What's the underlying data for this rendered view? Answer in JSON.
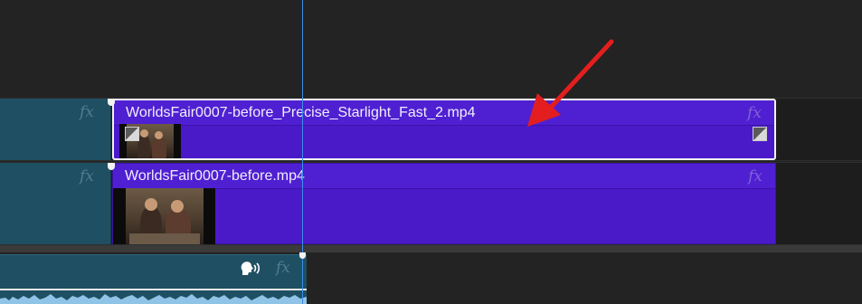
{
  "tracks": {
    "v2": {
      "left_fx": "fx",
      "clip": {
        "name": "WorldsFair0007-before_Precise_Starlight_Fast_2.mp4",
        "fx": "fx",
        "selected": true
      }
    },
    "v1": {
      "left_fx": "fx",
      "clip": {
        "name": "WorldsFair0007-before.mp4",
        "fx": "fx"
      }
    },
    "a1": {
      "fx": "fx",
      "voice_icon": "speaking-head-icon"
    }
  },
  "annotation": {
    "arrow_color": "#e41e1e"
  },
  "colors": {
    "video_clip": "#4a1ac9",
    "teal_clip": "#1f4f62",
    "playhead": "#3a8ee6",
    "background": "#232323"
  }
}
